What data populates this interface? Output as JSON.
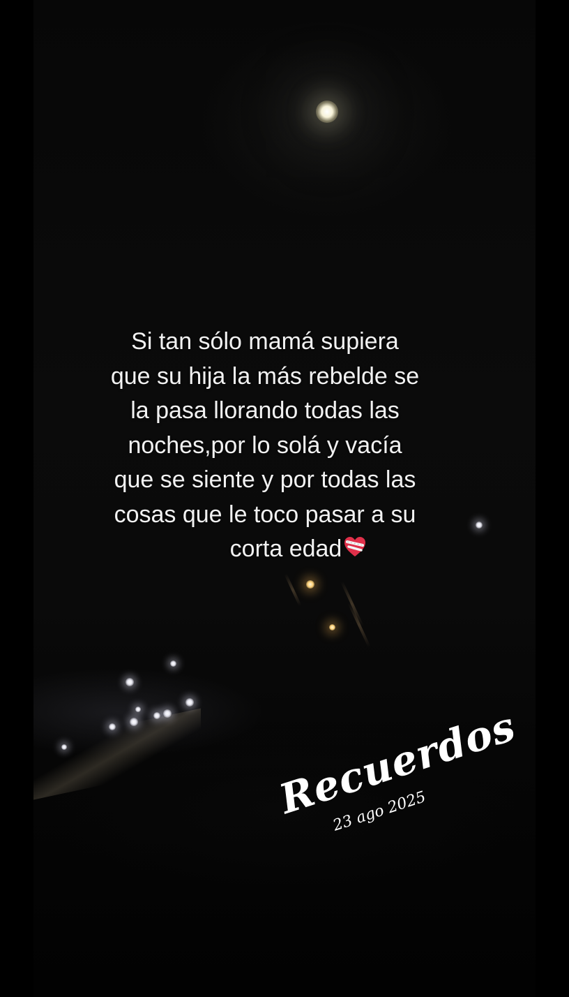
{
  "story": {
    "quote_lines": [
      "Si tan sólo mamá supiera",
      "que su hija la más rebelde se",
      "la pasa llorando todas las",
      "noches,por lo solá y vacía",
      "que se siente y por todas las",
      "cosas que le toco pasar a su",
      "corta edad"
    ],
    "quote_end_icon": "mending-heart-icon",
    "signature": {
      "word": "Recuerdos",
      "date": "23 ago 2025"
    }
  },
  "colors": {
    "text": "#f2f2f2",
    "background": "#000000",
    "heart": "#e0304a"
  }
}
